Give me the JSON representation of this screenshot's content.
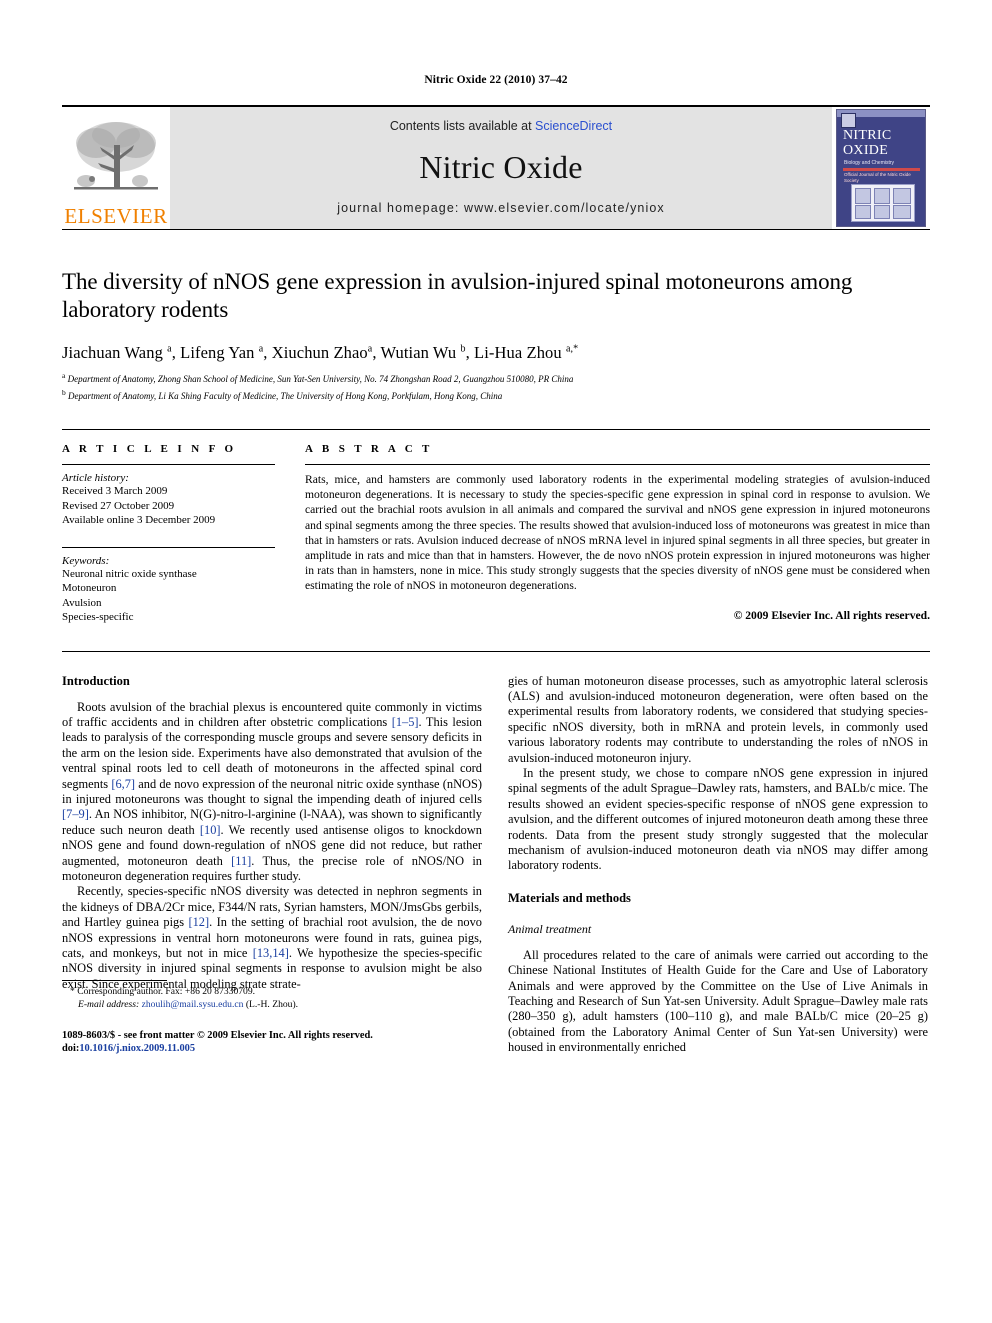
{
  "running_head": "Nitric Oxide 22 (2010) 37–42",
  "banner": {
    "publisher_wordmark": "ELSEVIER",
    "contents_prefix": "Contents lists available at ",
    "contents_link": "ScienceDirect",
    "journal_name": "Nitric Oxide",
    "homepage": "journal homepage: www.elsevier.com/locate/yniox",
    "cover": {
      "line1": "NITRIC",
      "line2": "OXIDE",
      "subtitle": "Biology and Chemistry",
      "society": "Official Journal of the Nitric Oxide Society"
    }
  },
  "article": {
    "title": "The diversity of nNOS gene expression in avulsion-injured spinal motoneurons among laboratory rodents",
    "authors": "Jiachuan Wang a, Lifeng Yan a, Xiuchun Zhao a, Wutian Wu b, Li-Hua Zhou a,*",
    "affiliation_a": "Department of Anatomy, Zhong Shan School of Medicine, Sun Yat-Sen University, No. 74 Zhongshan Road 2, Guangzhou 510080, PR China",
    "affiliation_b": "Department of Anatomy, Li Ka Shing Faculty of Medicine, The University of Hong Kong, Porkfulam, Hong Kong, China"
  },
  "info": {
    "heading": "A R T I C L E    I N F O",
    "history_label": "Article history:",
    "received": "Received 3 March 2009",
    "revised": "Revised 27 October 2009",
    "available": "Available online 3 December 2009",
    "keywords_label": "Keywords:",
    "keywords": [
      "Neuronal nitric oxide synthase",
      "Motoneuron",
      "Avulsion",
      "Species-specific"
    ]
  },
  "abstract": {
    "heading": "A B S T R A C T",
    "text": "Rats, mice, and hamsters are commonly used laboratory rodents in the experimental modeling strategies of avulsion-induced motoneuron degenerations. It is necessary to study the species-specific gene expression in spinal cord in response to avulsion. We carried out the brachial roots avulsion in all animals and compared the survival and nNOS gene expression in injured motoneurons and spinal segments among the three species. The results showed that avulsion-induced loss of motoneurons was greatest in mice than that in hamsters or rats. Avulsion induced decrease of nNOS mRNA level in injured spinal segments in all three species, but greater in amplitude in rats and mice than that in hamsters. However, the de novo nNOS protein expression in injured motoneurons was higher in rats than in hamsters, none in mice. This study strongly suggests that the species diversity of nNOS gene must be considered when estimating the role of nNOS in motoneuron degenerations.",
    "copyright": "© 2009 Elsevier Inc. All rights reserved."
  },
  "sections": {
    "introduction_heading": "Introduction",
    "intro_p1_a": "Roots avulsion of the brachial plexus is encountered quite commonly in victims of traffic accidents and in children after obstetric complications ",
    "intro_p1_cite1": "[1–5]",
    "intro_p1_b": ". This lesion leads to paralysis of the corresponding muscle groups and severe sensory deficits in the arm on the lesion side. Experiments have also demonstrated that avulsion of the ventral spinal roots led to cell death of motoneurons in the affected spinal cord segments ",
    "intro_p1_cite2": "[6,7]",
    "intro_p1_c": " and de novo expression of the neuronal nitric oxide synthase (nNOS) in injured motoneurons was thought to signal the impending death of injured cells ",
    "intro_p1_cite3": "[7–9]",
    "intro_p1_d": ". An NOS inhibitor, N(G)-nitro-l-arginine (l-NAA), was shown to significantly reduce such neuron death ",
    "intro_p1_cite4": "[10]",
    "intro_p1_e": ". We recently used antisense oligos to knockdown nNOS gene and found down-regulation of nNOS gene did not reduce, but rather augmented, motoneuron death ",
    "intro_p1_cite5": "[11]",
    "intro_p1_f": ". Thus, the precise role of nNOS/NO in motoneuron degeneration requires further study.",
    "intro_p2_a": "Recently, species-specific nNOS diversity was detected in nephron segments in the kidneys of DBA/2Cr mice, F344/N rats, Syrian hamsters, MON/JmsGbs gerbils, and Hartley guinea pigs ",
    "intro_p2_cite1": "[12]",
    "intro_p2_b": ". In the setting of brachial root avulsion, the de novo nNOS expressions in ventral horn motoneurons were found in rats, guinea pigs, cats, and monkeys, but not in mice ",
    "intro_p2_cite2": "[13,14]",
    "intro_p2_c": ". We hypothesize the species-specific nNOS diversity in injured spinal segments in response to avulsion might be also exist. Since experimental modeling strategies of human motoneuron disease processes, such as amyotrophic lateral sclerosis (ALS) and avulsion-induced motoneuron degeneration, were often based on the experimental results from laboratory rodents, we considered that studying species-specific nNOS diversity, both in mRNA and protein levels, in commonly used various laboratory rodents may contribute to understanding the roles of nNOS in avulsion-induced motoneuron injury.",
    "intro_p3": "In the present study, we chose to compare nNOS gene expression in injured spinal segments of the adult Sprague–Dawley rats, hamsters, and BALb/c mice. The results showed an evident species-specific response of nNOS gene expression to avulsion, and the different outcomes of injured motoneuron death among these three rodents. Data from the present study strongly suggested that the molecular mechanism of avulsion-induced motoneuron death via nNOS may differ among laboratory rodents.",
    "materials_heading": "Materials and methods",
    "animal_heading": "Animal treatment",
    "animal_p1": "All procedures related to the care of animals were carried out according to the Chinese National Institutes of Health Guide for the Care and Use of Laboratory Animals and were approved by the Committee on the Use of Live Animals in Teaching and Research of Sun Yat-sen University. Adult Sprague–Dawley male rats (280–350 g), adult hamsters (100–110 g), and male BALb/C mice (20–25 g) (obtained from the Laboratory Animal Center of Sun Yat-sen University) were housed in environmentally enriched"
  },
  "footnotes": {
    "corresponding": "Corresponding author. Fax: +86 20 87330709.",
    "email_label": "E-mail address:",
    "email": "zhoulih@mail.sysu.edu.cn",
    "email_suffix": " (L.-H. Zhou).",
    "issn_line": "1089-8603/$ - see front matter © 2009 Elsevier Inc. All rights reserved.",
    "doi_label": "doi:",
    "doi": "10.1016/j.niox.2009.11.005"
  },
  "colors": {
    "link": "#1a3fa0",
    "sciencedirect": "#2a4fcf",
    "elsevier_orange": "#F08000",
    "cover_blue": "#3f4486"
  }
}
